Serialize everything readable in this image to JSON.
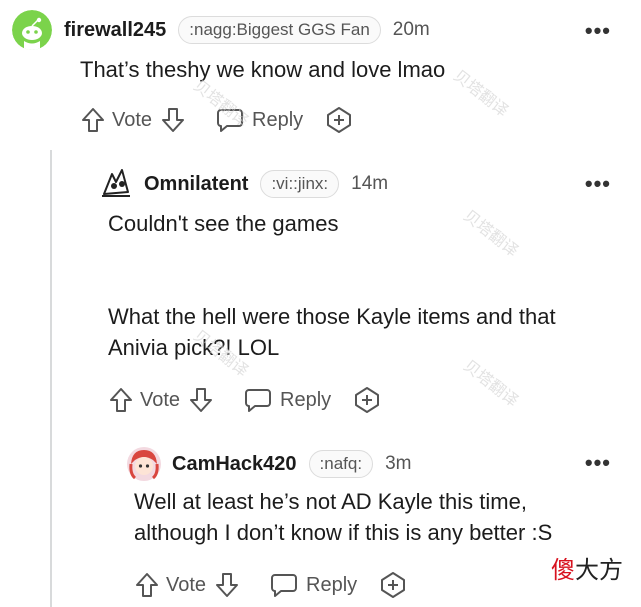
{
  "comments": [
    {
      "username": "firewall245",
      "flair": ":nagg:Biggest GGS Fan",
      "time": "20m",
      "more": "•••",
      "lines": [
        "That’s theshy we know and love lmao"
      ],
      "vote_label": "Vote",
      "reply_label": "Reply"
    },
    {
      "username": "Omnilatent",
      "flair": ":vi::jinx:",
      "time": "14m",
      "more": "•••",
      "lines": [
        "Couldn't see the games",
        "What the hell were those Kayle items and that",
        "Anivia pick?! LOL"
      ],
      "vote_label": "Vote",
      "reply_label": "Reply"
    },
    {
      "username": "CamHack420",
      "flair": ":nafq:",
      "time": "3m",
      "more": "•••",
      "lines": [
        "Well at least he’s not AD Kayle this time,",
        "although I don’t know if this is any better :S"
      ],
      "vote_label": "Vote",
      "reply_label": "Reply"
    }
  ],
  "watermark_text": "贝塔翻译",
  "corner_mark": {
    "red": "傻",
    "dark": "大方"
  },
  "colors": {
    "avatar_green": "#7bd34b",
    "text": "#1c1c1c",
    "meta": "#555555",
    "thread_line": "#d8dadb"
  }
}
